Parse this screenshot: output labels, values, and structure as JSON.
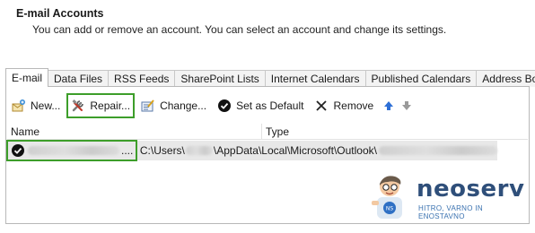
{
  "header": {
    "title": "E-mail Accounts",
    "subtitle": "You can add or remove an account. You can select an account and change its settings."
  },
  "tabs": [
    {
      "label": "E-mail",
      "active": true
    },
    {
      "label": "Data Files",
      "active": false
    },
    {
      "label": "RSS Feeds",
      "active": false
    },
    {
      "label": "SharePoint Lists",
      "active": false
    },
    {
      "label": "Internet Calendars",
      "active": false
    },
    {
      "label": "Published Calendars",
      "active": false
    },
    {
      "label": "Address Books",
      "active": false
    }
  ],
  "toolbar": {
    "new_label": "New...",
    "repair_label": "Repair...",
    "change_label": "Change...",
    "default_label": "Set as Default",
    "remove_label": "Remove"
  },
  "list": {
    "col_name": "Name",
    "col_type": "Type",
    "rows": [
      {
        "name_suffix": "....",
        "type_prefix": "C:\\Users\\",
        "type_middle": "\\AppData\\Local\\Microsoft\\Outlook\\"
      }
    ]
  },
  "logo": {
    "brand": "neoserv",
    "tagline": "HITRO, VARNO IN ENOSTAVNO"
  },
  "colors": {
    "highlight": "#3d9e2a",
    "arrow_up": "#2d6fd6",
    "arrow_down": "#9a9a9a",
    "brand": "#2f4f7a"
  }
}
